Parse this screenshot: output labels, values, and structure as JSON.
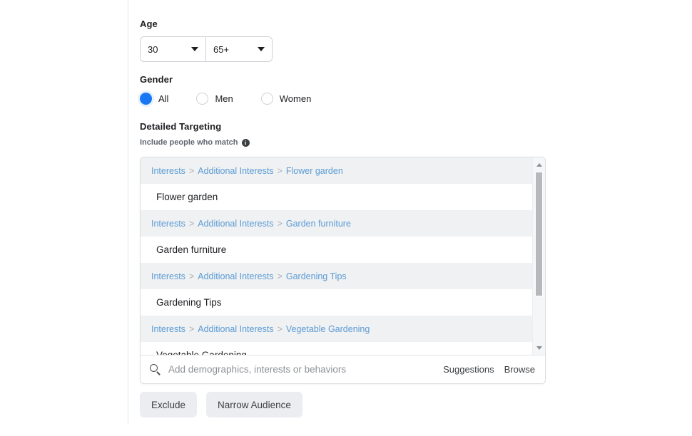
{
  "age": {
    "label": "Age",
    "min": {
      "value": "30",
      "icon": "chevron-down-icon"
    },
    "max": {
      "value": "65+",
      "icon": "chevron-down-icon"
    }
  },
  "gender": {
    "label": "Gender",
    "options": [
      {
        "label": "All",
        "selected": true
      },
      {
        "label": "Men",
        "selected": false
      },
      {
        "label": "Women",
        "selected": false
      }
    ],
    "accent_color": "#1877f2"
  },
  "detailed_targeting": {
    "label": "Detailed Targeting",
    "sublabel": "Include people who match",
    "info_icon": "info-icon",
    "info_glyph": "i",
    "results": [
      {
        "crumb": [
          "Interests",
          "Additional Interests",
          "Flower garden"
        ],
        "item": "Flower garden"
      },
      {
        "crumb": [
          "Interests",
          "Additional Interests",
          "Garden furniture"
        ],
        "item": "Garden furniture"
      },
      {
        "crumb": [
          "Interests",
          "Additional Interests",
          "Gardening Tips"
        ],
        "item": "Gardening Tips"
      },
      {
        "crumb": [
          "Interests",
          "Additional Interests",
          "Vegetable Gardening"
        ],
        "item": "Vegetable Gardening"
      }
    ],
    "crumb_separator": ">",
    "crumb_color": "#5a9bd5",
    "scrollbar": {
      "up_icon": "triangle-up-icon",
      "down_icon": "triangle-down-icon"
    },
    "search": {
      "icon": "search-icon",
      "value": "",
      "placeholder": "Add demographics, interests or behaviors",
      "suggestions_label": "Suggestions",
      "browse_label": "Browse"
    }
  },
  "actions": {
    "exclude_label": "Exclude",
    "narrow_label": "Narrow Audience"
  }
}
